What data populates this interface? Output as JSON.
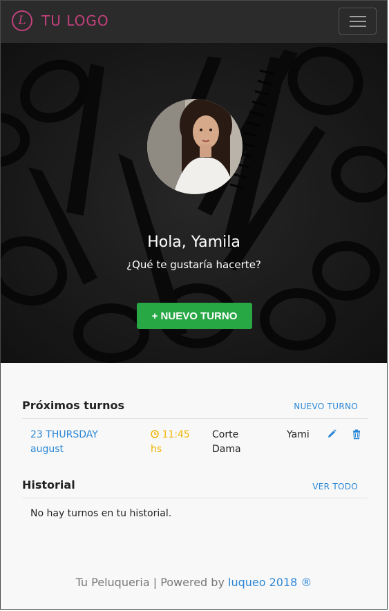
{
  "navbar": {
    "logo_letter": "L",
    "brand": "TU LOGO",
    "brand_color": "#c3407d",
    "menu_icon": "hamburger-icon"
  },
  "hero": {
    "greeting": "Hola, Yamila",
    "question": "¿Qué te gustaría hacerte?",
    "new_button": "+ NUEVO TURNO",
    "button_color": "#28a745"
  },
  "upcoming": {
    "title": "Próximos turnos",
    "link": "NUEVO TURNO",
    "rows": [
      {
        "date_line1": "23 THURSDAY",
        "date_line2": "august",
        "time_line1": "11:45",
        "time_line2": "hs",
        "service_line1": "Corte",
        "service_line2": "Dama",
        "person": "Yami",
        "edit_icon": "pencil-icon",
        "delete_icon": "trash-icon"
      }
    ]
  },
  "history": {
    "title": "Historial",
    "link": "VER TODO",
    "empty_text": "No hay turnos en tu historial."
  },
  "footer": {
    "text": "Tu Peluqueria | Powered by ",
    "link": "luqueo 2018 ®"
  },
  "colors": {
    "link": "#2a86d6",
    "time": "#f0b400",
    "navbar": "#2b2b2b"
  }
}
